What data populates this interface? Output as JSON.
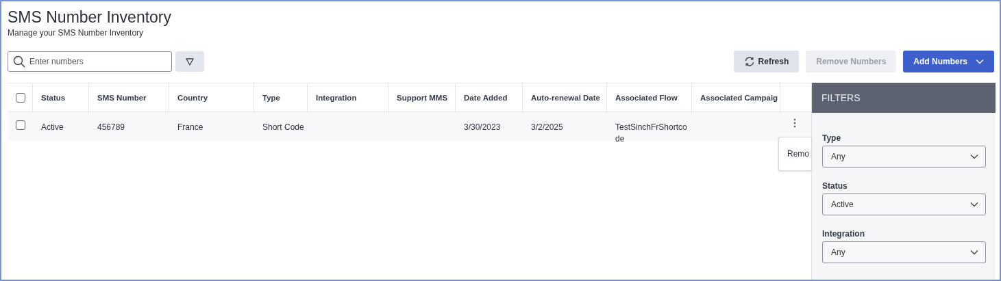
{
  "page": {
    "title": "SMS Number Inventory",
    "subtitle": "Manage your SMS Number Inventory"
  },
  "search": {
    "placeholder": "Enter numbers"
  },
  "buttons": [
    {
      "label": "Refresh",
      "kind": "refresh",
      "disabled": false
    },
    {
      "label": "Remove Numbers",
      "kind": "plain",
      "disabled": true
    },
    {
      "label": "Add Numbers",
      "kind": "primary",
      "disabled": false
    }
  ],
  "table": {
    "select_all_checked": false,
    "columns": [
      "Status",
      "SMS Number",
      "Country",
      "Type",
      "Integration",
      "Support MMS",
      "Date Added",
      "Auto-renewal Date",
      "Associated Flow",
      "Associated Campaig"
    ],
    "rows": [
      {
        "checked": false,
        "cells": [
          "Active",
          "456789",
          "France",
          "Short Code",
          "",
          "",
          "3/30/2023",
          "3/2/2025",
          "TestSinchFrShortcode",
          ""
        ]
      }
    ]
  },
  "row_menu": {
    "items": [
      "Remo"
    ]
  },
  "filters": {
    "title": "FILTERS",
    "fields": [
      {
        "label": "Type",
        "value": "Any"
      },
      {
        "label": "Status",
        "value": "Active"
      },
      {
        "label": "Integration",
        "value": "Any"
      }
    ]
  }
}
